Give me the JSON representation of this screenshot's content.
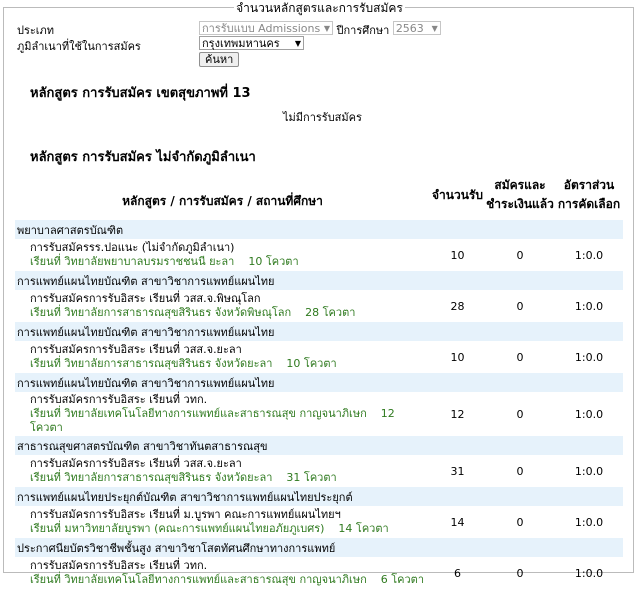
{
  "legend": "จำนวนหลักสูตรและการรับสมัคร",
  "form": {
    "type_label": "ประเภท",
    "type_value": "การรับแบบ Admissions",
    "year_label": "ปีการศึกษา",
    "year_value": "2563",
    "region_label": "ภูมิลำเนาที่ใช้ในการสมัคร",
    "region_value": "กรุงเทพมหานคร",
    "search_button": "ค้นหา"
  },
  "section1": {
    "title": "หลักสูตร การรับสมัคร เขตสุขภาพที่ 13",
    "empty": "ไม่มีการรับสมัคร"
  },
  "section2": {
    "title": "หลักสูตร การรับสมัคร ไม่จำกัดภูมิลำเนา"
  },
  "table": {
    "headers": {
      "program": "หลักสูตร / การรับสมัคร / สถานที่ศึกษา",
      "quota": "จำนวนรับ",
      "applied": "สมัครและชำระเงินแล้ว",
      "ratio": "อัตราส่วนการคัดเลือก"
    },
    "rows": [
      {
        "group": "พยาบาลศาสตรบัณฑิต",
        "name": "การรับสมัครรร.ปอแนะ (ไม่จำกัดภูมิลำเนา)",
        "place": "เรียนที่ วิทยาลัยพยาบาลบรมราชชนนี ยะลา",
        "quota_text": "10 โควตา",
        "quota": "10",
        "applied": "0",
        "ratio": "1:0.0"
      },
      {
        "group": "การแพทย์แผนไทยบัณฑิต สาขาวิชาการแพทย์แผนไทย",
        "name": "การรับสมัครการรับอิสระ เรียนที่ วสส.จ.พิษณุโลก",
        "place": "เรียนที่ วิทยาลัยการสาธารณสุขสิรินธร จังหวัดพิษณุโลก",
        "quota_text": "28 โควตา",
        "quota": "28",
        "applied": "0",
        "ratio": "1:0.0"
      },
      {
        "group": "การแพทย์แผนไทยบัณฑิต สาขาวิชาการแพทย์แผนไทย",
        "name": "การรับสมัครการรับอิสระ เรียนที่ วสส.จ.ยะลา",
        "place": "เรียนที่ วิทยาลัยการสาธารณสุขสิรินธร จังหวัดยะลา",
        "quota_text": "10 โควตา",
        "quota": "10",
        "applied": "0",
        "ratio": "1:0.0"
      },
      {
        "group": "การแพทย์แผนไทยบัณฑิต สาขาวิชาการแพทย์แผนไทย",
        "name": "การรับสมัครการรับอิสระ เรียนที่ วทก.",
        "place": "เรียนที่ วิทยาลัยเทคโนโลยีทางการแพทย์และสาธารณสุข กาญจนาภิเษก",
        "quota_text": "12 โควตา",
        "quota": "12",
        "applied": "0",
        "ratio": "1:0.0"
      },
      {
        "group": "สาธารณสุขศาสตรบัณฑิต สาขาวิชาทันตสาธารณสุข",
        "name": "การรับสมัครการรับอิสระ เรียนที่ วสส.จ.ยะลา",
        "place": "เรียนที่ วิทยาลัยการสาธารณสุขสิรินธร จังหวัดยะลา",
        "quota_text": "31 โควตา",
        "quota": "31",
        "applied": "0",
        "ratio": "1:0.0"
      },
      {
        "group": "การแพทย์แผนไทยประยุกต์บัณฑิต สาขาวิชาการแพทย์แผนไทยประยุกต์",
        "name": "การรับสมัครการรับอิสระ เรียนที่ ม.บูรพา คณะการแพทย์แผนไทยฯ",
        "place": "เรียนที่ มหาวิทยาลัยบูรพา (คณะการแพทย์แผนไทยอภัยภูเบศร)",
        "quota_text": "14 โควตา",
        "quota": "14",
        "applied": "0",
        "ratio": "1:0.0"
      },
      {
        "group": "ประกาศนียบัตรวิชาชีพชั้นสูง สาขาวิชาโสตทัศนศึกษาทางการแพทย์",
        "name": "การรับสมัครการรับอิสระ เรียนที่ วทก.",
        "place": "เรียนที่ วิทยาลัยเทคโนโลยีทางการแพทย์และสาธารณสุข กาญจนาภิเษก",
        "quota_text": "6 โควตา",
        "quota": "6",
        "applied": "0",
        "ratio": "1:0.0"
      }
    ]
  }
}
